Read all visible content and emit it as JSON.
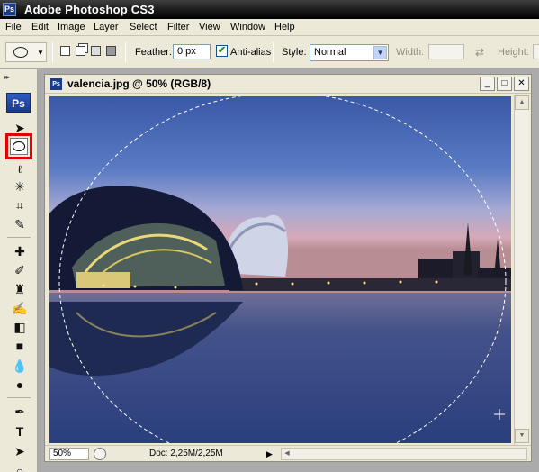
{
  "app": {
    "title": "Adobe Photoshop CS3",
    "logo_text": "Ps"
  },
  "menu": [
    "File",
    "Edit",
    "Image",
    "Layer",
    "Select",
    "Filter",
    "View",
    "Window",
    "Help"
  ],
  "options": {
    "feather_label": "Feather:",
    "feather_value": "0 px",
    "antialias_label": "Anti-alias",
    "antialias_checked": true,
    "style_label": "Style:",
    "style_value": "Normal",
    "width_label": "Width:",
    "height_label": "Height:"
  },
  "toolbox": {
    "logo": "Ps",
    "selected_tool": "elliptical-marquee",
    "highlight_color": "#e30000"
  },
  "document": {
    "title": "valencia.jpg @ 50% (RGB/8)",
    "icon_text": "Ps",
    "zoom": "50%",
    "doc_info": "Doc: 2,25M/2,25M"
  },
  "colors": {
    "title_bar": "#1c1c1c",
    "chrome": "#ece9d8",
    "sky_top": "#3c5da7",
    "horizon": "#d8a6b6"
  }
}
